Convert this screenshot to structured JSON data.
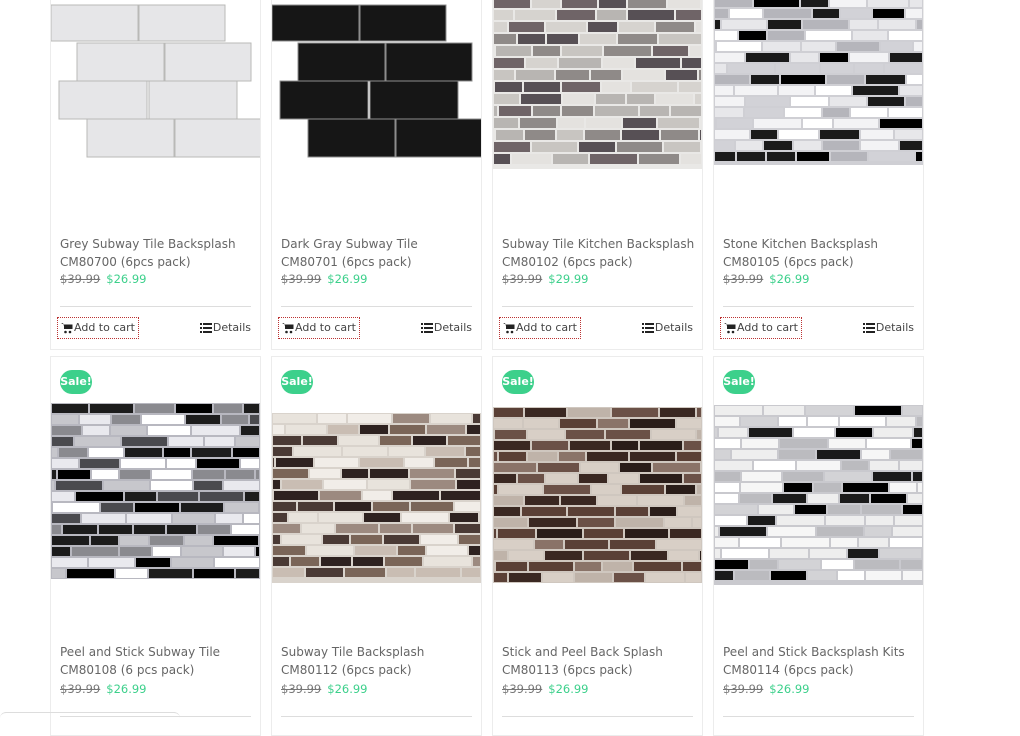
{
  "products": [
    {
      "title": "Grey Subway Tile Backsplash CM80700 (6pcs pack)",
      "old_price": "$39.99",
      "new_price": "$26.99",
      "cart_label": "Add to cart",
      "details_label": "Details",
      "sale": "",
      "image": "grey-marble-subway-tile"
    },
    {
      "title": "Dark Gray Subway Tile CM80701 (6pcs pack)",
      "old_price": "$39.99",
      "new_price": "$26.99",
      "cart_label": "Add to cart",
      "details_label": "Details",
      "sale": "",
      "image": "black-subway-tile"
    },
    {
      "title": "Subway Tile Kitchen Backsplash CM80102 (6pcs pack)",
      "old_price": "$39.99",
      "new_price": "$29.99",
      "cart_label": "Add to cart",
      "details_label": "Details",
      "sale": "",
      "image": "grey-mosaic-tile"
    },
    {
      "title": "Stone Kitchen Backsplash CM80105 (6pcs pack)",
      "old_price": "$39.99",
      "new_price": "$26.99",
      "cart_label": "Add to cart",
      "details_label": "Details",
      "sale": "",
      "image": "black-white-stone-tile"
    },
    {
      "title": "Peel and Stick Subway Tile CM80108 (6 pcs pack)",
      "old_price": "$39.99",
      "new_price": "$26.99",
      "sale": "Sale!",
      "image": "black-grey-glass-tile"
    },
    {
      "title": "Subway Tile Backsplash CM80112 (6pcs pack)",
      "old_price": "$39.99",
      "new_price": "$26.99",
      "sale": "Sale!",
      "image": "brown-beige-stone-tile"
    },
    {
      "title": "Stick and Peel Back Splash CM80113 (6pcs pack)",
      "old_price": "$39.99",
      "new_price": "$26.99",
      "sale": "Sale!",
      "image": "dark-brown-tile"
    },
    {
      "title": "Peel and Stick Backsplash Kits CM80114 (6pcs pack)",
      "old_price": "$39.99",
      "new_price": "$26.99",
      "sale": "Sale!",
      "image": "white-black-glass-tile"
    }
  ],
  "colors": {
    "accent": "#3cd08b",
    "sale_badge": "#3cd08b",
    "price_old": "#777777",
    "text": "#666666"
  }
}
